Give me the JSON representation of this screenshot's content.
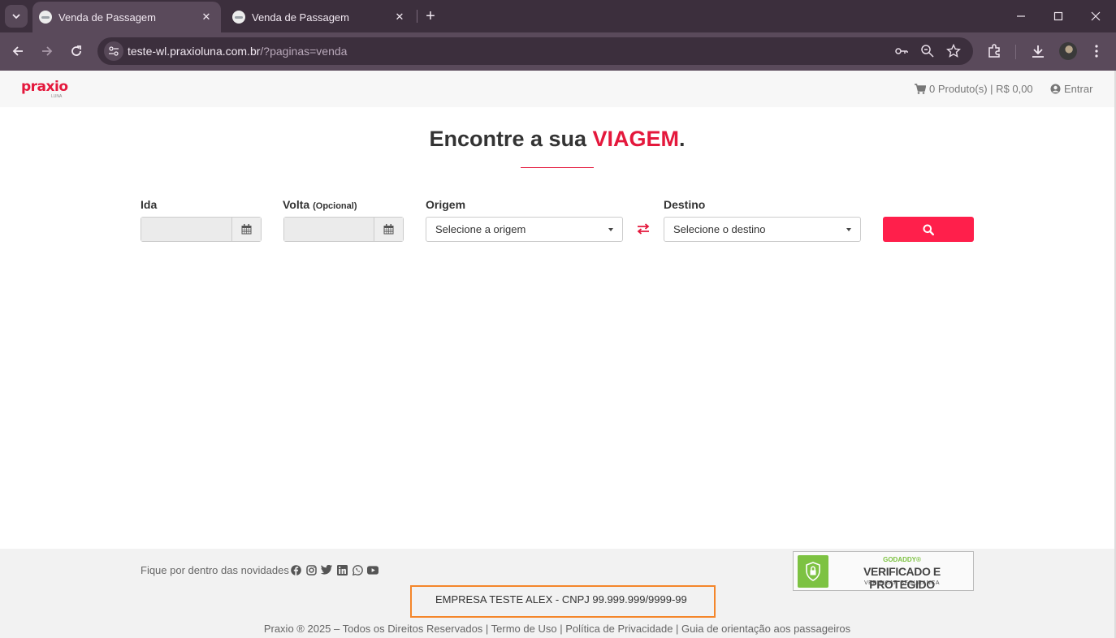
{
  "browser": {
    "tabs": [
      {
        "title": "Venda de Passagem",
        "active": true
      },
      {
        "title": "Venda de Passagem",
        "active": false
      }
    ],
    "url_host": "teste-wl.praxioluna.com.br",
    "url_path": "/?paginas=venda"
  },
  "header": {
    "logo_text": "praxio",
    "logo_sub": "LUNA",
    "cart_text": "0 Produto(s) | R$ 0,00",
    "login_text": "Entrar"
  },
  "search": {
    "title_prefix": "Encontre a sua ",
    "title_accent": "VIAGEM",
    "title_suffix": ".",
    "ida_label": "Ida",
    "volta_label": "Volta",
    "volta_optional": "(Opcional)",
    "origem_label": "Origem",
    "origem_value": "Selecione a origem",
    "destino_label": "Destino",
    "destino_value": "Selecione o destino"
  },
  "footer": {
    "news_text": "Fique por dentro das novidades",
    "social": [
      "facebook-icon",
      "instagram-icon",
      "twitter-icon",
      "linkedin-icon",
      "whatsapp-icon",
      "youtube-icon"
    ],
    "badge_top": "GODADDY®",
    "badge_main": "VERIFICADO E PROTEGIDO",
    "badge_sub": "VERIFICAR SEGURANÇA",
    "company": "EMPRESA TESTE ALEX - CNPJ 99.999.999/9999-99",
    "copyright": "Praxio ® 2025 – Todos os Direitos Reservados | Termo de Uso | Política de Privacidade | Guia de orientação aos passageiros"
  },
  "colors": {
    "accent": "#e4183c",
    "search_button": "#ff1f4b",
    "highlight_box": "#f4862a"
  }
}
